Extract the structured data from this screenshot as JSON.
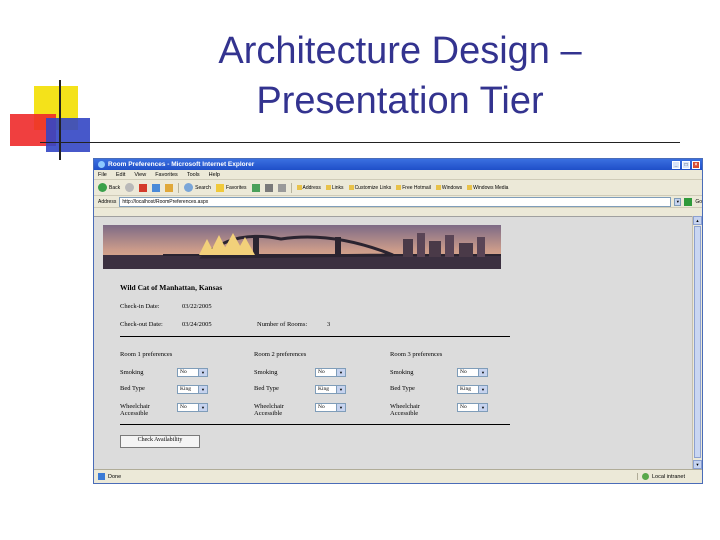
{
  "slide": {
    "title_line1": "Architecture Design –",
    "title_line2": "Presentation Tier"
  },
  "browser": {
    "window_title": "Room Preferences - Microsoft Internet Explorer",
    "window_buttons": [
      "_",
      "□",
      "×"
    ],
    "menu": [
      "File",
      "Edit",
      "View",
      "Favorites",
      "Tools",
      "Help"
    ],
    "toolbar": {
      "back_label": "Back",
      "search_label": "Search",
      "favorites_label": "Favorites",
      "links": [
        "Address",
        "Links",
        "Customize Links",
        "Free Hotmail",
        "Windows",
        "Windows Media"
      ]
    },
    "address": {
      "label": "Address",
      "value": "http://localhost/RoomPreferences.aspx",
      "go_label": "Go"
    },
    "status": {
      "text": "Done",
      "zone": "Local intranet"
    }
  },
  "page": {
    "hotel_name": "Wild Cat of Manhattan, Kansas",
    "checkin_label": "Check-in Date:",
    "checkin_value": "03/22/2005",
    "checkout_label": "Check-out Date:",
    "checkout_value": "03/24/2005",
    "rooms_label": "Number of Rooms:",
    "rooms_value": "3",
    "rooms": [
      {
        "heading": "Room 1 preferences",
        "smoking_label": "Smoking",
        "smoking": "No",
        "bed_label": "Bed Type",
        "bed": "King",
        "wheelchair_label": "Wheelchair Accessible",
        "wheelchair": "No"
      },
      {
        "heading": "Room 2 preferences",
        "smoking_label": "Smoking",
        "smoking": "No",
        "bed_label": "Bed Type",
        "bed": "King",
        "wheelchair_label": "Wheelchair Accessible",
        "wheelchair": "No"
      },
      {
        "heading": "Room 3 preferences",
        "smoking_label": "Smoking",
        "smoking": "No",
        "bed_label": "Bed Type",
        "bed": "King",
        "wheelchair_label": "Wheelchair Accessible",
        "wheelchair": "No"
      }
    ],
    "check_button": "Check Availability"
  },
  "colors": {
    "title": "#33338f",
    "titlebar": "#1f4fc8",
    "viewport_bg": "#dcdcdc"
  }
}
